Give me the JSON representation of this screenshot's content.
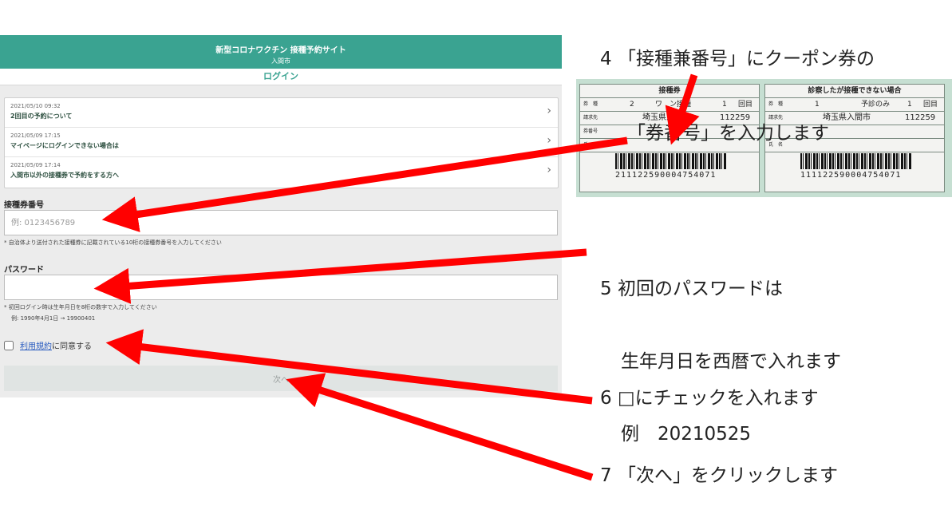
{
  "site": {
    "title": "新型コロナワクチン 接種予約サイト",
    "city": "入間市",
    "login_label": "ログイン",
    "news": [
      {
        "date": "2021/05/10 09:32",
        "title": "2回目の予約について"
      },
      {
        "date": "2021/05/09 17:15",
        "title": "マイページにログインできない場合は"
      },
      {
        "date": "2021/05/09 17:14",
        "title": "入間市以外の接種券で予約をする方へ"
      }
    ],
    "ticket_field": {
      "label": "接種券番号",
      "placeholder": "例: 0123456789",
      "hint": "* 自治体より送付された接種券に記載されている10桁の接種券番号を入力してください"
    },
    "password_field": {
      "label": "パスワード",
      "hint1": "* 初回ログイン時は生年月日を8桁の数字で入力してください",
      "hint2": "例: 1990年4月1日 → 19900401"
    },
    "agree": {
      "link": "利用規約",
      "text": "に同意する"
    },
    "next_button": "次へ"
  },
  "ticket_photo": {
    "left": {
      "header": "接種券",
      "row1": {
        "k": "券　種",
        "num": "2",
        "type": "ワ　ン接種",
        "count": "1",
        "unit": "回目"
      },
      "row2": {
        "k": "請求先",
        "city": "埼玉県入間市",
        "code": "112259"
      },
      "row3": {
        "k": "券番号"
      },
      "row4": {
        "k": "氏　名"
      },
      "barcode_number": "211122590004754071"
    },
    "right": {
      "header": "診察したが接種できない場合",
      "row1": {
        "k": "券　種",
        "num": "1",
        "type": "予診のみ",
        "count": "1",
        "unit": "回目"
      },
      "row2": {
        "k": "請求先",
        "city": "埼玉県入間市",
        "code": "112259"
      },
      "row3": {
        "k": ""
      },
      "row4": {
        "k": "氏　名"
      },
      "barcode_number": "111122590004754071"
    }
  },
  "annotations": {
    "step4_line1": "4 「接種兼番号」にクーポン券の",
    "step4_line2": "「券番号」を入力します",
    "step5_line1": "5 初回のパスワードは",
    "step5_line2": "生年月日を西暦で入れます",
    "step5_line3": "例　20210525",
    "step6": "6 □にチェックを入れます",
    "step7": "7 「次へ」をクリックします"
  },
  "colors": {
    "header": "#3aa391",
    "arrow": "#ff0000"
  }
}
